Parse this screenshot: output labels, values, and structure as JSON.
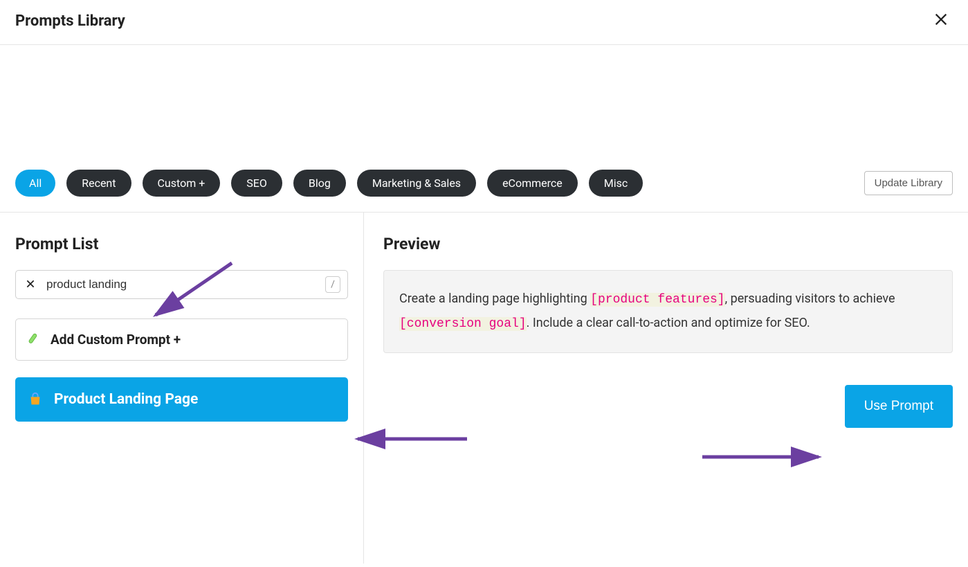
{
  "header": {
    "title": "Prompts Library"
  },
  "filters": {
    "tabs": [
      "All",
      "Recent",
      "Custom +",
      "SEO",
      "Blog",
      "Marketing & Sales",
      "eCommerce",
      "Misc"
    ],
    "update_label": "Update Library"
  },
  "left": {
    "title": "Prompt List",
    "search_value": "product landing",
    "slash_hint": "/",
    "add_custom_label": "Add Custom Prompt +",
    "selected_prompt": "Product Landing Page"
  },
  "right": {
    "title": "Preview",
    "preview_pre": "Create a landing page highlighting ",
    "ph1": "[product features]",
    "preview_mid": ", persuading visitors to achieve ",
    "ph2": "[conversion goal]",
    "preview_post": ". Include a clear call-to-action and optimize for SEO.",
    "use_label": "Use Prompt"
  }
}
